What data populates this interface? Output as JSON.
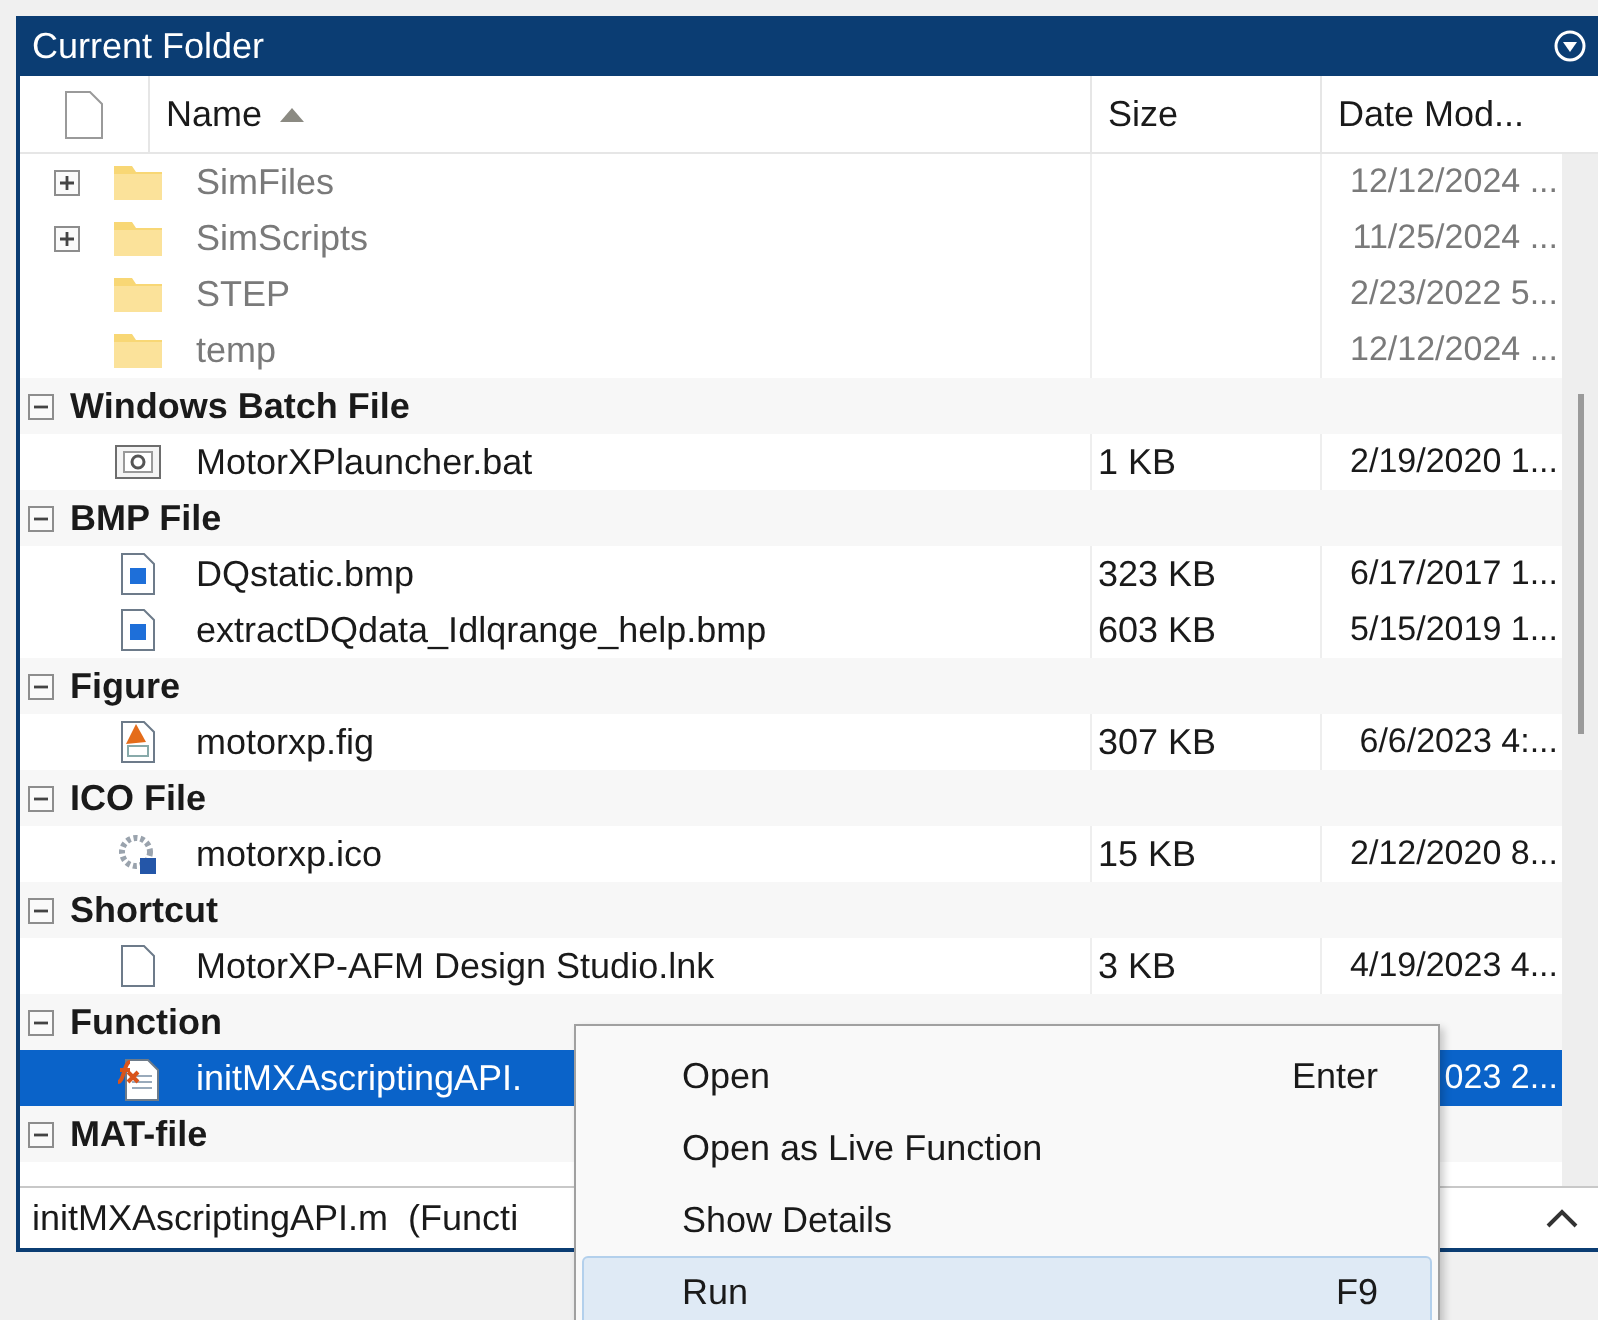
{
  "panel": {
    "title": "Current Folder"
  },
  "columns": [
    {
      "label": "Name",
      "sorted": true
    },
    {
      "label": "Size",
      "sorted": false
    },
    {
      "label": "Date Mod...",
      "sorted": false
    }
  ],
  "folders": [
    {
      "name": "SimFiles",
      "has_children": true,
      "date": "12/12/2024 ..."
    },
    {
      "name": "SimScripts",
      "has_children": true,
      "date": "11/25/2024 ..."
    },
    {
      "name": "STEP",
      "has_children": false,
      "date": "2/23/2022 5..."
    },
    {
      "name": "temp",
      "has_children": false,
      "date": "12/12/2024 ..."
    }
  ],
  "groups": [
    {
      "label": "Windows Batch File",
      "expanded": true,
      "files": [
        {
          "name": "MotorXPlauncher.bat",
          "kind": "batch",
          "size": "1 KB",
          "date": "2/19/2020 1...",
          "selected": false
        }
      ]
    },
    {
      "label": "BMP File",
      "expanded": true,
      "files": [
        {
          "name": "DQstatic.bmp",
          "kind": "bmp",
          "size": "323 KB",
          "date": "6/17/2017 1...",
          "selected": false
        },
        {
          "name": "extractDQdata_Idlqrange_help.bmp",
          "kind": "bmp",
          "size": "603 KB",
          "date": "5/15/2019 1...",
          "selected": false
        }
      ]
    },
    {
      "label": "Figure",
      "expanded": true,
      "files": [
        {
          "name": "motorxp.fig",
          "kind": "fig",
          "size": "307 KB",
          "date": "6/6/2023 4:...",
          "selected": false
        }
      ]
    },
    {
      "label": "ICO File",
      "expanded": true,
      "files": [
        {
          "name": "motorxp.ico",
          "kind": "ico",
          "size": "15 KB",
          "date": "2/12/2020 8...",
          "selected": false
        }
      ]
    },
    {
      "label": "Shortcut",
      "expanded": true,
      "files": [
        {
          "name": "MotorXP-AFM Design Studio.lnk",
          "kind": "shortcut",
          "size": "3 KB",
          "date": "4/19/2023 4...",
          "selected": false
        }
      ]
    },
    {
      "label": "Function",
      "expanded": true,
      "files": [
        {
          "name": "initMXAscriptingAPI.",
          "kind": "function",
          "date": "023 2...",
          "selected": true
        }
      ]
    },
    {
      "label": "MAT-file",
      "expanded": true
    }
  ],
  "status_bar": {
    "text": "initMXAscriptingAPI.m  (Functi"
  },
  "context_menu": {
    "items": [
      {
        "label": "Open",
        "shortcut": "Enter",
        "highlighted": false
      },
      {
        "label": "Open as Live Function",
        "highlighted": false
      },
      {
        "label": "Show Details",
        "highlighted": false
      },
      {
        "label": "Run",
        "shortcut": "F9",
        "highlighted": true
      }
    ]
  }
}
